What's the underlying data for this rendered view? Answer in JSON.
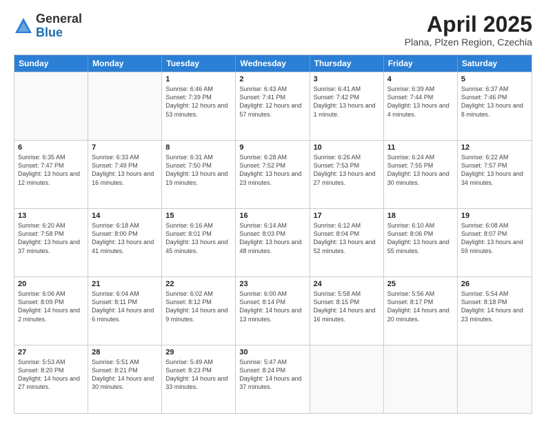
{
  "header": {
    "logo": {
      "general": "General",
      "blue": "Blue"
    },
    "title": "April 2025",
    "location": "Plana, Plzen Region, Czechia"
  },
  "calendar": {
    "days": [
      "Sunday",
      "Monday",
      "Tuesday",
      "Wednesday",
      "Thursday",
      "Friday",
      "Saturday"
    ],
    "rows": [
      [
        {
          "day": "",
          "text": ""
        },
        {
          "day": "",
          "text": ""
        },
        {
          "day": "1",
          "text": "Sunrise: 6:46 AM\nSunset: 7:39 PM\nDaylight: 12 hours and 53 minutes."
        },
        {
          "day": "2",
          "text": "Sunrise: 6:43 AM\nSunset: 7:41 PM\nDaylight: 12 hours and 57 minutes."
        },
        {
          "day": "3",
          "text": "Sunrise: 6:41 AM\nSunset: 7:42 PM\nDaylight: 13 hours and 1 minute."
        },
        {
          "day": "4",
          "text": "Sunrise: 6:39 AM\nSunset: 7:44 PM\nDaylight: 13 hours and 4 minutes."
        },
        {
          "day": "5",
          "text": "Sunrise: 6:37 AM\nSunset: 7:46 PM\nDaylight: 13 hours and 8 minutes."
        }
      ],
      [
        {
          "day": "6",
          "text": "Sunrise: 6:35 AM\nSunset: 7:47 PM\nDaylight: 13 hours and 12 minutes."
        },
        {
          "day": "7",
          "text": "Sunrise: 6:33 AM\nSunset: 7:49 PM\nDaylight: 13 hours and 16 minutes."
        },
        {
          "day": "8",
          "text": "Sunrise: 6:31 AM\nSunset: 7:50 PM\nDaylight: 13 hours and 19 minutes."
        },
        {
          "day": "9",
          "text": "Sunrise: 6:28 AM\nSunset: 7:52 PM\nDaylight: 13 hours and 23 minutes."
        },
        {
          "day": "10",
          "text": "Sunrise: 6:26 AM\nSunset: 7:53 PM\nDaylight: 13 hours and 27 minutes."
        },
        {
          "day": "11",
          "text": "Sunrise: 6:24 AM\nSunset: 7:55 PM\nDaylight: 13 hours and 30 minutes."
        },
        {
          "day": "12",
          "text": "Sunrise: 6:22 AM\nSunset: 7:57 PM\nDaylight: 13 hours and 34 minutes."
        }
      ],
      [
        {
          "day": "13",
          "text": "Sunrise: 6:20 AM\nSunset: 7:58 PM\nDaylight: 13 hours and 37 minutes."
        },
        {
          "day": "14",
          "text": "Sunrise: 6:18 AM\nSunset: 8:00 PM\nDaylight: 13 hours and 41 minutes."
        },
        {
          "day": "15",
          "text": "Sunrise: 6:16 AM\nSunset: 8:01 PM\nDaylight: 13 hours and 45 minutes."
        },
        {
          "day": "16",
          "text": "Sunrise: 6:14 AM\nSunset: 8:03 PM\nDaylight: 13 hours and 48 minutes."
        },
        {
          "day": "17",
          "text": "Sunrise: 6:12 AM\nSunset: 8:04 PM\nDaylight: 13 hours and 52 minutes."
        },
        {
          "day": "18",
          "text": "Sunrise: 6:10 AM\nSunset: 8:06 PM\nDaylight: 13 hours and 55 minutes."
        },
        {
          "day": "19",
          "text": "Sunrise: 6:08 AM\nSunset: 8:07 PM\nDaylight: 13 hours and 59 minutes."
        }
      ],
      [
        {
          "day": "20",
          "text": "Sunrise: 6:06 AM\nSunset: 8:09 PM\nDaylight: 14 hours and 2 minutes."
        },
        {
          "day": "21",
          "text": "Sunrise: 6:04 AM\nSunset: 8:11 PM\nDaylight: 14 hours and 6 minutes."
        },
        {
          "day": "22",
          "text": "Sunrise: 6:02 AM\nSunset: 8:12 PM\nDaylight: 14 hours and 9 minutes."
        },
        {
          "day": "23",
          "text": "Sunrise: 6:00 AM\nSunset: 8:14 PM\nDaylight: 14 hours and 13 minutes."
        },
        {
          "day": "24",
          "text": "Sunrise: 5:58 AM\nSunset: 8:15 PM\nDaylight: 14 hours and 16 minutes."
        },
        {
          "day": "25",
          "text": "Sunrise: 5:56 AM\nSunset: 8:17 PM\nDaylight: 14 hours and 20 minutes."
        },
        {
          "day": "26",
          "text": "Sunrise: 5:54 AM\nSunset: 8:18 PM\nDaylight: 14 hours and 23 minutes."
        }
      ],
      [
        {
          "day": "27",
          "text": "Sunrise: 5:53 AM\nSunset: 8:20 PM\nDaylight: 14 hours and 27 minutes."
        },
        {
          "day": "28",
          "text": "Sunrise: 5:51 AM\nSunset: 8:21 PM\nDaylight: 14 hours and 30 minutes."
        },
        {
          "day": "29",
          "text": "Sunrise: 5:49 AM\nSunset: 8:23 PM\nDaylight: 14 hours and 33 minutes."
        },
        {
          "day": "30",
          "text": "Sunrise: 5:47 AM\nSunset: 8:24 PM\nDaylight: 14 hours and 37 minutes."
        },
        {
          "day": "",
          "text": ""
        },
        {
          "day": "",
          "text": ""
        },
        {
          "day": "",
          "text": ""
        }
      ]
    ]
  }
}
